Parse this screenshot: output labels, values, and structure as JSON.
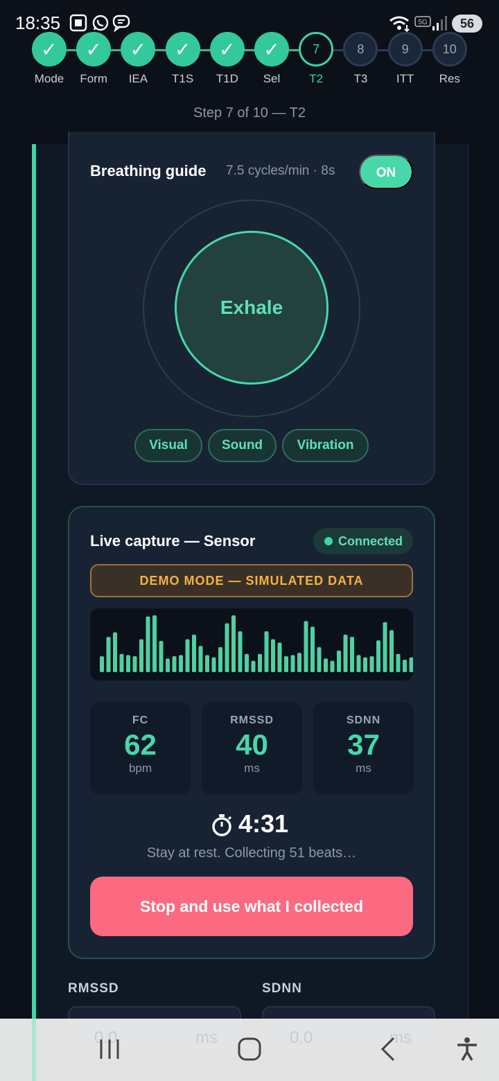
{
  "status_bar": {
    "time": "18:35",
    "battery": "56",
    "icons": [
      "screenshot-icon",
      "whatsapp-icon",
      "message-icon",
      "wifi-icon",
      "5g-icon",
      "signal-icon",
      "battery-icon"
    ]
  },
  "stepper": {
    "steps": [
      {
        "label": "Mode",
        "number": "1",
        "state": "done"
      },
      {
        "label": "Form",
        "number": "2",
        "state": "done"
      },
      {
        "label": "IEA",
        "number": "3",
        "state": "done"
      },
      {
        "label": "T1S",
        "number": "4",
        "state": "done"
      },
      {
        "label": "T1D",
        "number": "5",
        "state": "done"
      },
      {
        "label": "Sel",
        "number": "6",
        "state": "done"
      },
      {
        "label": "T2",
        "number": "7",
        "state": "current"
      },
      {
        "label": "T3",
        "number": "8",
        "state": "future"
      },
      {
        "label": "ITT",
        "number": "9",
        "state": "future"
      },
      {
        "label": "Res",
        "number": "10",
        "state": "future"
      }
    ],
    "check_glyph": "✓",
    "caption": "Step 7 of 10 — T2"
  },
  "breathing_guide": {
    "title": "Breathing guide",
    "rate": "7.5 cycles/min · 8s",
    "toggle_label": "ON",
    "phase": "Exhale",
    "modes": [
      "Visual",
      "Sound",
      "Vibration"
    ]
  },
  "live_capture": {
    "title": "Live capture — Sensor",
    "status": "Connected",
    "demo_banner": "DEMO MODE — SIMULATED DATA",
    "waveform_levels": [
      0.28,
      0.62,
      0.7,
      0.32,
      0.3,
      0.28,
      0.58,
      0.98,
      1.0,
      0.55,
      0.24,
      0.28,
      0.3,
      0.58,
      0.66,
      0.46,
      0.3,
      0.26,
      0.44,
      0.86,
      1.0,
      0.72,
      0.32,
      0.2,
      0.32,
      0.72,
      0.58,
      0.52,
      0.28,
      0.3,
      0.34,
      0.9,
      0.8,
      0.44,
      0.24,
      0.2,
      0.38,
      0.66,
      0.62,
      0.3,
      0.26,
      0.28,
      0.56,
      0.88,
      0.74,
      0.32,
      0.22,
      0.26
    ],
    "waveform_color": "#4fd0a0",
    "metrics": [
      {
        "label": "FC",
        "value": "62",
        "unit": "bpm"
      },
      {
        "label": "RMSSD",
        "value": "40",
        "unit": "ms"
      },
      {
        "label": "SDNN",
        "value": "37",
        "unit": "ms"
      }
    ],
    "timer": "4:31",
    "timer_hint": "Stay at rest. Collecting 51 beats…",
    "stop_button": "Stop and use what I collected"
  },
  "manual_entry": {
    "rmssd_label": "RMSSD",
    "sdnn_label": "SDNN",
    "rmssd_value": "0.0",
    "rmssd_unit": "ms",
    "sdnn_value": "0.0",
    "sdnn_unit": "ms"
  },
  "colors": {
    "accent": "#3dd6a3",
    "danger": "#fb6a80",
    "warning": "#f3b43f",
    "background": "#0b1019"
  },
  "nav_bar": {
    "buttons": [
      "recent-apps-icon",
      "home-icon",
      "back-icon",
      "accessibility-icon"
    ]
  }
}
